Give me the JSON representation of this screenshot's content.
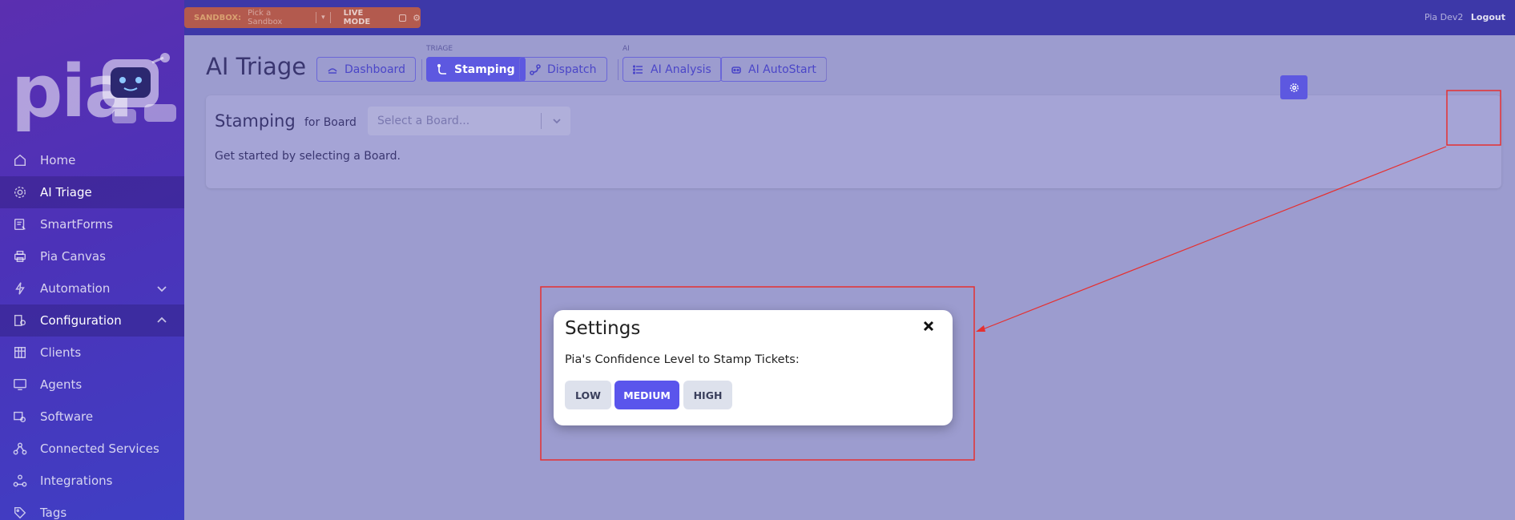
{
  "topbar": {
    "sandbox_label": "SANDBOX:",
    "sandbox_value": "Pick a Sandbox",
    "live_mode_label": "LIVE MODE",
    "user_name": "Pia Dev2",
    "logout_label": "Logout"
  },
  "brand": {
    "logo_text": "pia"
  },
  "sidebar": {
    "items": [
      {
        "label": "Home",
        "icon": "home-icon"
      },
      {
        "label": "AI Triage",
        "icon": "gear-icon"
      },
      {
        "label": "SmartForms",
        "icon": "form-icon"
      },
      {
        "label": "Pia Canvas",
        "icon": "printer-icon"
      },
      {
        "label": "Automation",
        "icon": "bolt-icon"
      },
      {
        "label": "Configuration",
        "icon": "config-icon"
      },
      {
        "label": "Clients",
        "icon": "building-icon"
      },
      {
        "label": "Agents",
        "icon": "monitor-icon"
      },
      {
        "label": "Software",
        "icon": "software-icon"
      },
      {
        "label": "Connected Services",
        "icon": "nodes-icon"
      },
      {
        "label": "Integrations",
        "icon": "integration-icon"
      },
      {
        "label": "Tags",
        "icon": "tag-icon"
      }
    ]
  },
  "page": {
    "title": "AI Triage",
    "triage_group_label": "TRIAGE",
    "ai_group_label": "AI",
    "tabs": {
      "dashboard": "Dashboard",
      "stamping": "Stamping",
      "dispatch": "Dispatch",
      "ai_analysis": "AI Analysis",
      "ai_autostart": "AI AutoStart"
    }
  },
  "card": {
    "title": "Stamping",
    "for_label": "for Board",
    "board_placeholder": "Select a Board...",
    "hint": "Get started by selecting a Board."
  },
  "modal": {
    "title": "Settings",
    "prompt": "Pia's Confidence Level to Stamp Tickets:",
    "levels": [
      "LOW",
      "MEDIUM",
      "HIGH"
    ],
    "selected_level": "MEDIUM"
  },
  "colors": {
    "accent": "#5d58e0",
    "annotation": "#e53030",
    "sandbox_pill": "#b35a4e"
  }
}
